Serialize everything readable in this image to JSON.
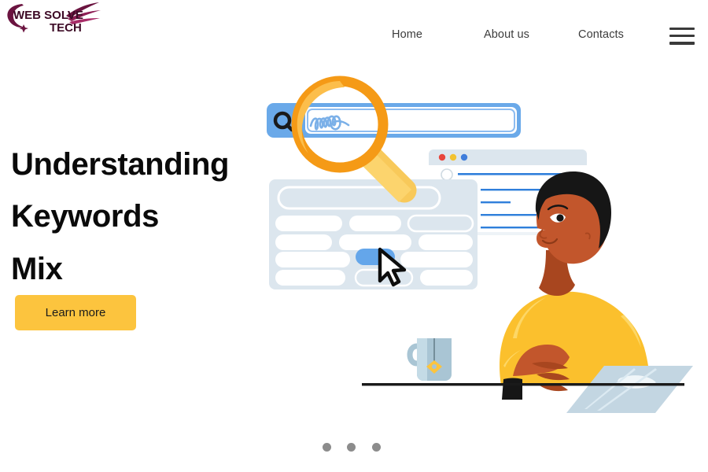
{
  "brand": {
    "name_line1": "WEB SOLVE",
    "name_line2": "TECH",
    "color": "#6b1440"
  },
  "nav": {
    "items": [
      {
        "label": "Home"
      },
      {
        "label": "About us"
      },
      {
        "label": "Contacts"
      }
    ],
    "menu_icon": "hamburger-icon"
  },
  "hero": {
    "title_line1": "Understanding",
    "title_line2": "Keywords",
    "title_line3": "Mix",
    "cta_label": "Learn more",
    "cta_color": "#fcc43e",
    "title_color": "#0a0a0a"
  },
  "illustration": {
    "name": "seo-keyword-search-illustration",
    "search_bar": {
      "icon": "magnifier-icon",
      "query_text": "handwritten-scribble",
      "border_color": "#6aa9e9",
      "field_fill": "#ffffff"
    },
    "magnifier": {
      "ring_color": "#f59a16",
      "inner_color": "#fbbe4b",
      "handle_color": "#fcc43e"
    },
    "result_card": {
      "background": "#dce6ee",
      "row_color": "#ffffff",
      "highlight_color": "#64a6ea",
      "cursor": "mouse-pointer-icon"
    },
    "browser_window": {
      "dots": [
        "#e8453c",
        "#f2c230",
        "#3f7ddb"
      ],
      "line_color": "#2f7fdb",
      "chrome_color": "#dce6ee"
    },
    "person": {
      "shirt_color": "#fbc02d",
      "skin_color": "#c2562c",
      "hair_color": "#161616"
    },
    "laptop": {
      "lid_color": "#c3d6e2",
      "base_color": "#dfeaf0"
    },
    "mug": {
      "body_color": "#a9c5d4",
      "tag_color": "#fcc43e"
    },
    "desk_line_color": "#1a1a1a"
  },
  "carousel": {
    "dot_color": "#8c8c8c",
    "dots": [
      {
        "label": "slide-1"
      },
      {
        "label": "slide-2"
      },
      {
        "label": "slide-3"
      }
    ]
  }
}
